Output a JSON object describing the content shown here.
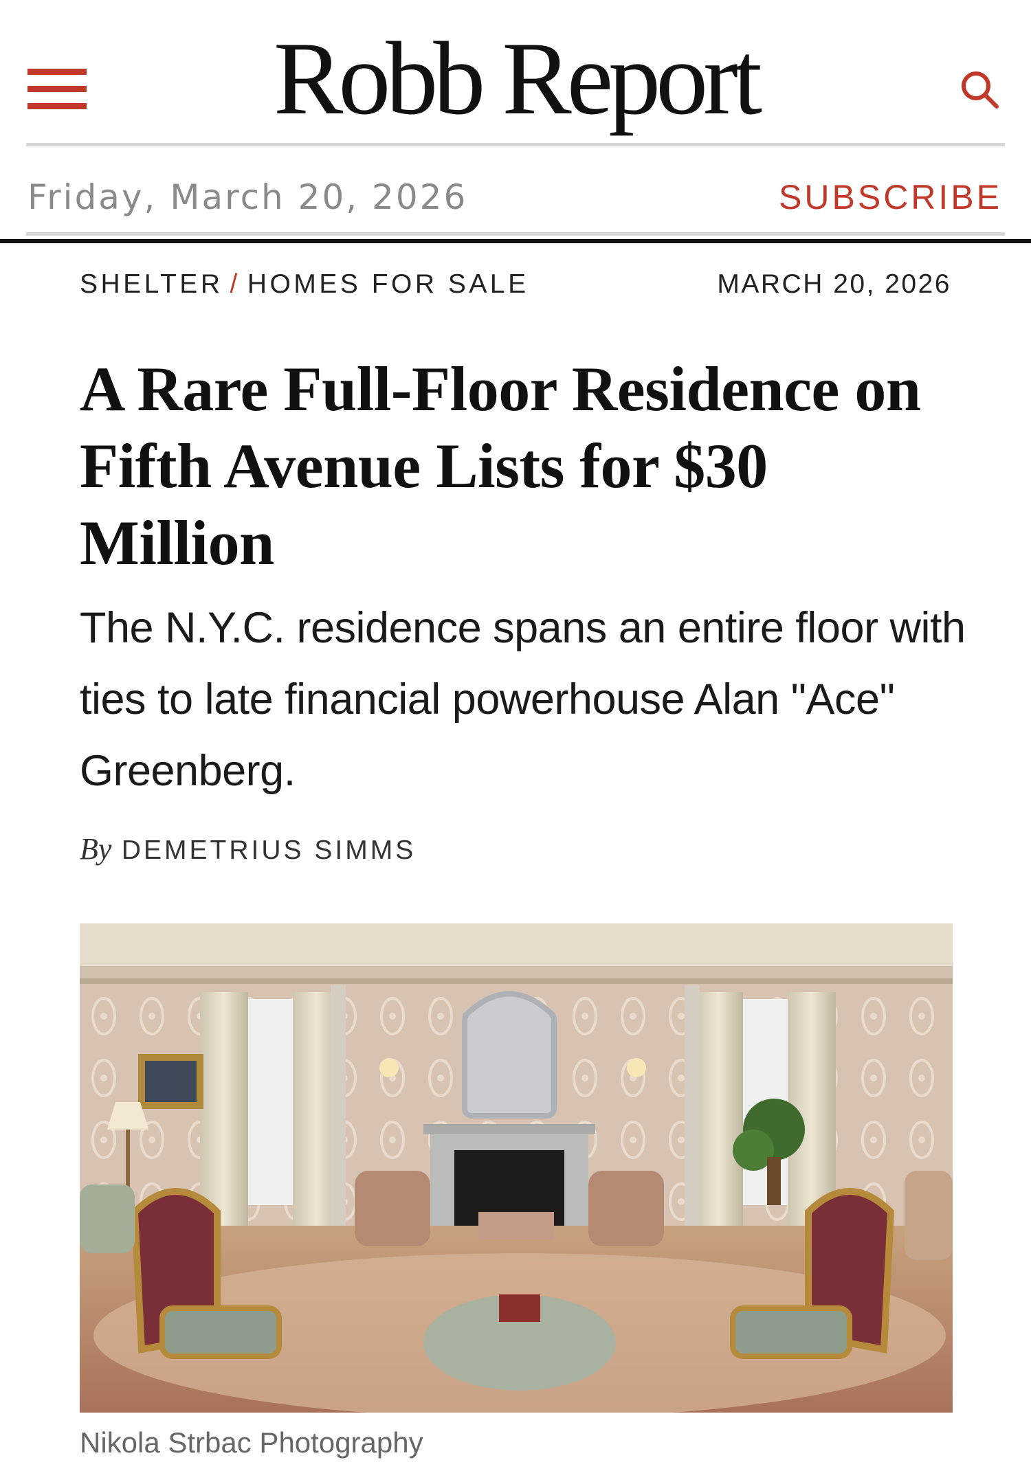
{
  "masthead": {
    "logo": "Robb Report",
    "menu_icon": "hamburger-menu-icon",
    "search_icon": "search-icon",
    "accent_color": "#c0392b"
  },
  "date_bar": {
    "today": "Friday, March 20, 2026",
    "subscribe_label": "SUBSCRIBE"
  },
  "article": {
    "breadcrumb": {
      "section": "SHELTER",
      "separator": "/",
      "subsection": "HOMES FOR SALE"
    },
    "date": "MARCH 20, 2026",
    "headline": "A Rare Full-Floor Residence on Fifth Avenue Lists for $30 Million",
    "dek": "The N.Y.C. residence spans an entire floor with ties to late financial powerhouse Alan \"Ace\" Greenberg.",
    "byline_prefix": "By",
    "author": "DEMETRIUS SIMMS",
    "image_caption": "Nikola Strbac Photography"
  }
}
